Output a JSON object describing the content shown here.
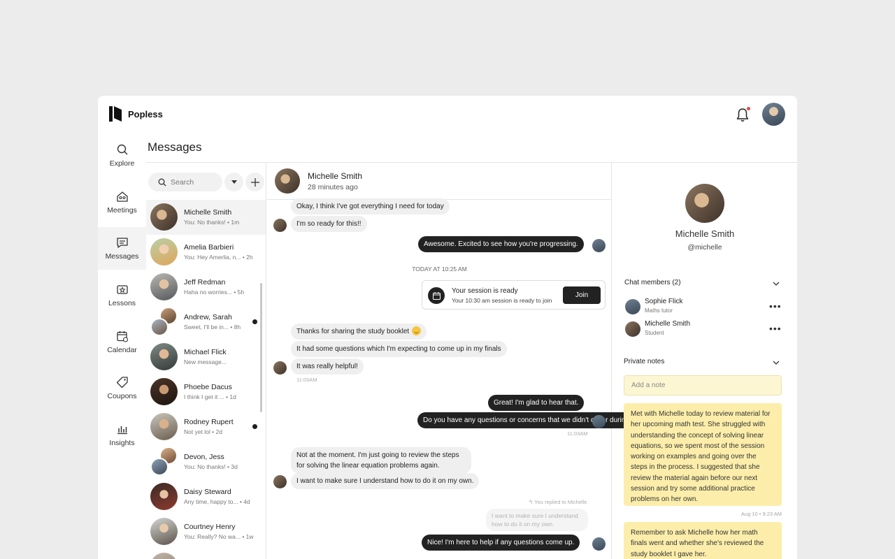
{
  "app": {
    "brand": "Popless",
    "page_title": "Messages"
  },
  "nav": [
    {
      "label": "Explore",
      "icon": "search-icon"
    },
    {
      "label": "Meetings",
      "icon": "meetings-icon"
    },
    {
      "label": "Messages",
      "icon": "messages-icon",
      "active": true
    },
    {
      "label": "Lessons",
      "icon": "lessons-icon"
    },
    {
      "label": "Calendar",
      "icon": "calendar-icon"
    },
    {
      "label": "Coupons",
      "icon": "coupon-icon"
    },
    {
      "label": "Insights",
      "icon": "insights-icon"
    }
  ],
  "search": {
    "placeholder": "Search"
  },
  "conversations": [
    {
      "name": "Michelle Smith",
      "preview": "You: No thanks! • 1m",
      "active": true,
      "unread": false
    },
    {
      "name": "Amelia Barbieri",
      "preview": "You: Hey Amerlia, n... • 2h",
      "unread": false
    },
    {
      "name": "Jeff Redman",
      "preview": "Haha no worries... • 5h",
      "unread": false
    },
    {
      "name": "Andrew, Sarah",
      "preview": "Sweet, I'll be in... • 8h",
      "unread": true,
      "group": true
    },
    {
      "name": "Michael Flick",
      "preview": "New message...",
      "unread": false
    },
    {
      "name": "Phoebe Dacus",
      "preview": "I think I get it ... • 1d",
      "unread": false
    },
    {
      "name": "Rodney Rupert",
      "preview": "Not yet lol • 2d",
      "unread": true
    },
    {
      "name": "Devon, Jess",
      "preview": "You: No thanks! • 3d",
      "unread": false,
      "group": true
    },
    {
      "name": "Daisy Steward",
      "preview": "Any time, happy to... • 4d",
      "unread": false
    },
    {
      "name": "Courtney Henry",
      "preview": "You: Really? No wa... • 1w",
      "unread": false
    }
  ],
  "chat": {
    "name": "Michelle Smith",
    "status": "28 minutes ago",
    "day_divider": "TODAY AT 10:25 AM",
    "messages": {
      "m1": "Okay, I think I've got everything I need for today",
      "m2": "I'm so ready for this!!",
      "m3": "Awesome. Excited to see how you're progressing.",
      "m4": "Thanks for sharing the study booklet",
      "m5": "It had some questions which I'm expecting to come up in my finals",
      "m6": "It was really helpful!",
      "t1": "11:03AM",
      "m7": "Great! I'm glad to hear that.",
      "m8": "Do you have any questions or concerns that we didn't cover during our meeting?",
      "t2": "11:03AM",
      "m9": "Not at the moment. I'm just going to review the steps for solving the linear equation problems again.",
      "m10": "I want to make sure I understand how to do it on my own.",
      "reply_label": "You replied to Michelle",
      "quoted": "I want to make sure I understand how to do it on my own.",
      "m11": "Nice! I'm here to help if any questions come up."
    },
    "session_card": {
      "title": "Your session is ready",
      "subtitle": "Your 10:30 am session is ready to join",
      "button": "Join"
    }
  },
  "profile": {
    "name": "Michelle Smith",
    "handle": "@michelle",
    "members_title": "Chat members (2)",
    "members": [
      {
        "name": "Sophie Flick",
        "role": "Maths tutor"
      },
      {
        "name": "Michelle Smith",
        "role": "Student"
      }
    ],
    "notes_title": "Private  notes",
    "note_placeholder": "Add a note",
    "notes": [
      {
        "text": "Met with Michelle today to review material for her upcoming math test. She struggled with understanding the concept of solving linear equations, so we spent most of the session working on examples and going over the steps in the process. I suggested that she review the material again before our next session and try some additional practice problems on her own.",
        "meta": "Aug 10 • 9:23 AM"
      },
      {
        "text": "Remember to ask Michelle how her math finals went and whether she's reviewed the study booklet I gave her."
      }
    ]
  },
  "colors": {
    "accent": "#222222",
    "note_bg": "#fceeaa",
    "notification_dot": "#e5484d"
  }
}
